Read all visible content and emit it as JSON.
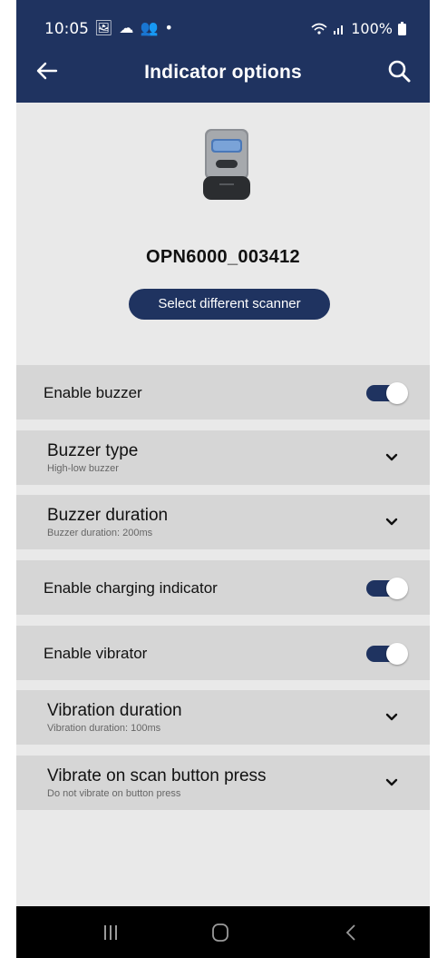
{
  "status_bar": {
    "time": "10:05",
    "left_icons": "🖼 ☁ 👥 •",
    "signal": "📶",
    "battery_text": "100%",
    "icon_names": [
      "gallery-icon",
      "cloud-icon",
      "teams-icon",
      "dot-icon",
      "wifi-icon",
      "signal-icon",
      "battery-icon"
    ]
  },
  "app_bar": {
    "title": "Indicator options",
    "back_icon": "arrow-left-icon",
    "search_icon": "search-icon",
    "color": "#1f3360"
  },
  "scanner": {
    "name": "OPN6000_003412",
    "select_button": "Select different scanner"
  },
  "settings": [
    {
      "label": "Enable buzzer",
      "type": "toggle",
      "on": true
    },
    {
      "label": "Buzzer type",
      "sub": "High-low buzzer",
      "type": "expand"
    },
    {
      "label": "Buzzer duration",
      "sub": "Buzzer duration: 200ms",
      "type": "expand"
    },
    {
      "label": "Enable charging indicator",
      "type": "toggle",
      "on": true
    },
    {
      "label": "Enable vibrator",
      "type": "toggle",
      "on": true
    },
    {
      "label": "Vibration duration",
      "sub": "Vibration duration: 100ms",
      "type": "expand"
    },
    {
      "label": "Vibrate on scan button press",
      "sub": "Do not vibrate on button press",
      "type": "expand"
    }
  ],
  "nav_bar": {
    "recent": "|||",
    "home": "○",
    "back": "<"
  }
}
